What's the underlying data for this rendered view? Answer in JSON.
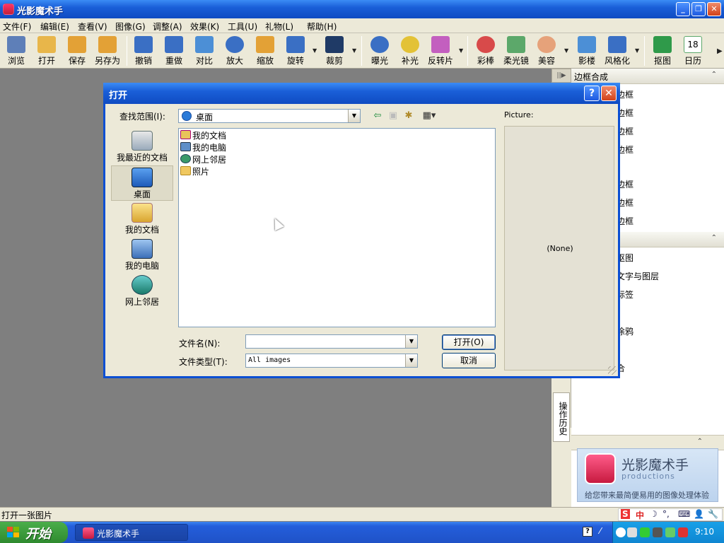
{
  "app": {
    "title": "光影魔术手",
    "window_controls": {
      "minimize": "_",
      "maximize": "❐",
      "close": "✕"
    }
  },
  "menu": [
    "文件(F)",
    "编辑(E)",
    "查看(V)",
    "图像(G)",
    "调整(A)",
    "效果(K)",
    "工具(U)",
    "礼物(L)",
    "帮助(H)"
  ],
  "toolbar": {
    "items": [
      {
        "label": "浏览",
        "icon": "eye-icon",
        "color": "#5e7fb8"
      },
      {
        "label": "打开",
        "icon": "folder-open-icon",
        "color": "#e8b64a"
      },
      {
        "label": "保存",
        "icon": "save-icon",
        "color": "#e3a136"
      },
      {
        "label": "另存为",
        "icon": "save-as-icon",
        "color": "#e3a136"
      },
      {
        "label": "撤销",
        "icon": "undo-icon",
        "color": "#3a6fc4"
      },
      {
        "label": "重做",
        "icon": "redo-icon",
        "color": "#3a6fc4"
      },
      {
        "label": "对比",
        "icon": "compare-icon",
        "color": "#4c8fd6"
      },
      {
        "label": "放大",
        "icon": "zoom-in-icon",
        "color": "#3a6fc4"
      },
      {
        "label": "缩放",
        "icon": "resize-icon",
        "color": "#e3a136"
      },
      {
        "label": "旋转",
        "icon": "rotate-icon",
        "color": "#3a6fc4"
      },
      {
        "label": "裁剪",
        "icon": "crop-icon",
        "color": "#1f3a66"
      },
      {
        "label": "曝光",
        "icon": "exposure-icon",
        "color": "#3a6fc4"
      },
      {
        "label": "补光",
        "icon": "fill-light-icon",
        "color": "#e3c236"
      },
      {
        "label": "反转片",
        "icon": "slide-film-icon",
        "color": "#c35fbf"
      },
      {
        "label": "彩棒",
        "icon": "color-wand-icon",
        "color": "#d84a4a"
      },
      {
        "label": "柔光镜",
        "icon": "soft-lens-icon",
        "color": "#5ca86a"
      },
      {
        "label": "美容",
        "icon": "beauty-icon",
        "color": "#e6a27a"
      },
      {
        "label": "影楼",
        "icon": "studio-icon",
        "color": "#4c8fd6"
      },
      {
        "label": "风格化",
        "icon": "stylize-icon",
        "color": "#3a6fc4"
      },
      {
        "label": "抠图",
        "icon": "cutout-icon",
        "color": "#2f9a4a"
      },
      {
        "label": "日历",
        "icon": "calendar-icon",
        "color": "#5ca86a",
        "text": "18"
      }
    ]
  },
  "right_panel": {
    "section1_title": "边框合成",
    "section1_items": [
      "边框",
      "边框",
      "边框",
      "边框",
      "边框",
      "边框",
      "边框"
    ],
    "section2_items": [
      "抠图",
      "文字与图层",
      "标签",
      "",
      "涂鸦",
      "",
      "合"
    ],
    "history_tab": "操作历史",
    "logo_name": "光影魔术手",
    "logo_sub": "productions",
    "logo_slogan": "给您带来最简便易用的图像处理体验"
  },
  "dialog": {
    "title": "打开",
    "help_label": "?",
    "close_label": "✕",
    "look_in_label": "查找范围(I):",
    "look_in_value": "桌面",
    "places": [
      {
        "label": "我最近的文档",
        "icon": "recent-docs-icon"
      },
      {
        "label": "桌面",
        "icon": "desktop-icon",
        "selected": true
      },
      {
        "label": "我的文档",
        "icon": "my-documents-icon"
      },
      {
        "label": "我的电脑",
        "icon": "my-computer-icon"
      },
      {
        "label": "网上邻居",
        "icon": "network-icon"
      }
    ],
    "files": [
      {
        "label": "我的文档",
        "icon": "my-documents-icon",
        "color": "#e8c45a"
      },
      {
        "label": "我的电脑",
        "icon": "my-computer-icon",
        "color": "#5e8fc8"
      },
      {
        "label": "网上邻居",
        "icon": "network-icon",
        "color": "#3a9a6a"
      },
      {
        "label": "照片",
        "icon": "folder-icon",
        "color": "#f0c860"
      }
    ],
    "preview_label": "Picture:",
    "preview_value": "(None)",
    "filename_label": "文件名(N):",
    "filename_value": "",
    "filetype_label": "文件类型(T):",
    "filetype_value": "All images",
    "open_button": "打开(O)",
    "cancel_button": "取消"
  },
  "status": {
    "text": "打开一张图片"
  },
  "ime": {
    "items": [
      "S",
      "中",
      "☽",
      "°,",
      "⌨",
      "👤",
      "🔧"
    ]
  },
  "taskbar": {
    "start_label": "开始",
    "task_label": "光影魔术手",
    "clock": "9:10"
  }
}
